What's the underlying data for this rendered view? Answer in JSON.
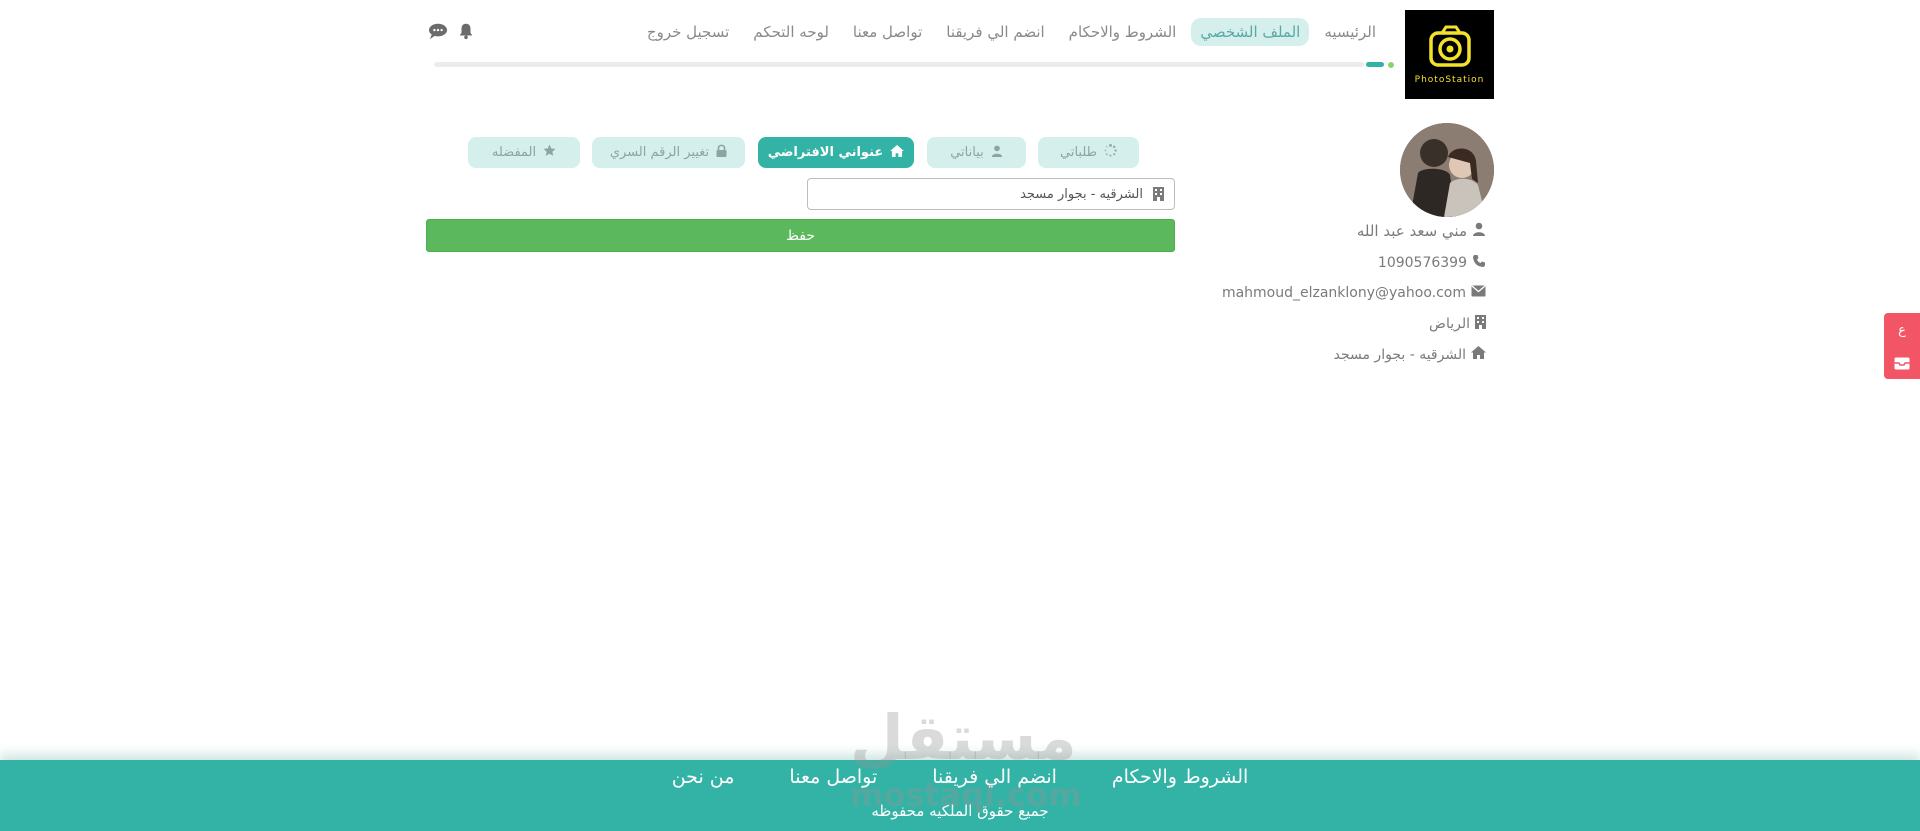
{
  "header": {
    "logo_text": "PhotoStation",
    "nav": [
      {
        "label": "الرئيسيه"
      },
      {
        "label": "الملف الشخصي",
        "active": true
      },
      {
        "label": "الشروط والاحكام"
      },
      {
        "label": "انضم الي فريقنا"
      },
      {
        "label": "تواصل معنا"
      },
      {
        "label": "لوحه التحكم"
      },
      {
        "label": "تسجيل خروج"
      }
    ],
    "icons": [
      "bell-icon",
      "chat-icon"
    ]
  },
  "profile": {
    "name": "مني سعد عبد الله",
    "phone": "1090576399",
    "email": "mahmoud_elzanklony@yahoo.com",
    "city": "الرياض",
    "address": "الشرقيه - بجوار مسجد"
  },
  "tabs": [
    {
      "label": "طلباتي",
      "icon": "spinner-icon"
    },
    {
      "label": "بياناتي",
      "icon": "user-icon"
    },
    {
      "label": "عنواني الافتراضي",
      "icon": "home-icon",
      "active": true
    },
    {
      "label": "تغيير الرقم السري",
      "icon": "lock-icon"
    },
    {
      "label": "المفضله",
      "icon": "star-icon"
    }
  ],
  "address_form": {
    "value": "الشرقيه - بجوار مسجد",
    "save_label": "حفظ"
  },
  "side_widget": {
    "icons": [
      "ar-toggle-icon",
      "inbox-icon"
    ],
    "lang_label": "ع"
  },
  "footer": {
    "links": [
      "الشروط والاحكام",
      "انضم الي فريقنا",
      "تواصل معنا",
      "من نحن"
    ],
    "copyright": "جميع حقوق الملكيه محفوظه"
  },
  "watermark": {
    "text": "مستقل",
    "sub": "mostaql.com"
  },
  "colors": {
    "accent": "#33b3a6",
    "accent_light": "#d4efec",
    "save": "#5cb85c",
    "widget": "#f25565"
  }
}
